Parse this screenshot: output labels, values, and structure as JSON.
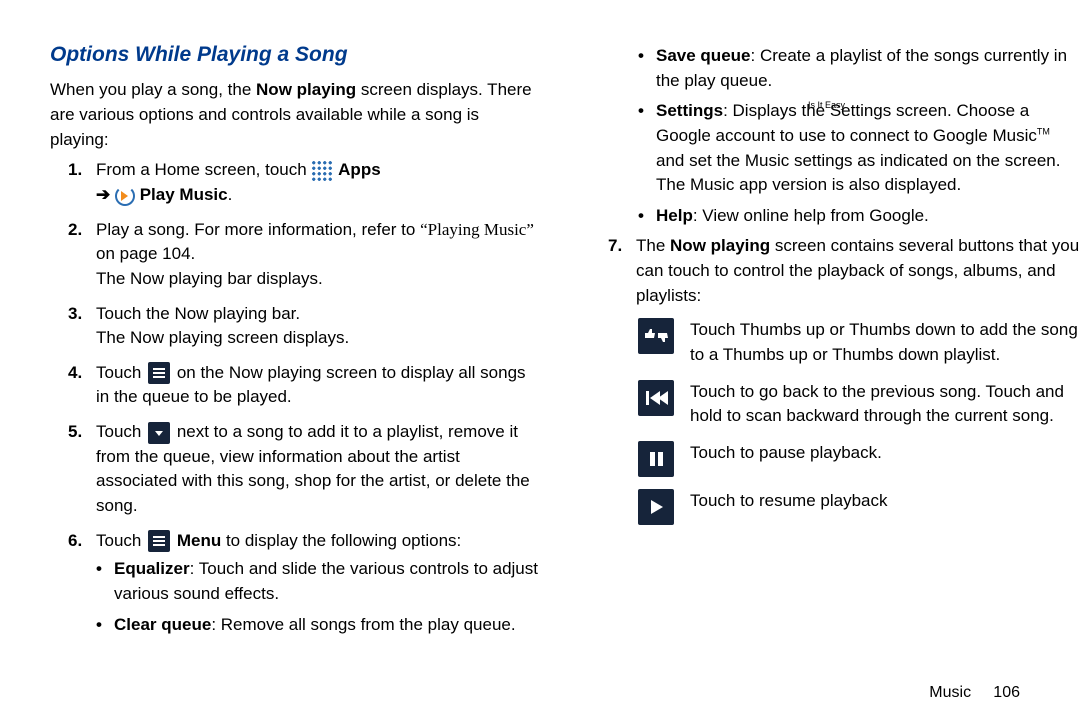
{
  "heading": "Options While Playing a Song",
  "intro": {
    "t1": "When you play a song, the ",
    "b1": "Now playing",
    "t2": " screen displays. There are various options and controls available while a song is playing:"
  },
  "step1": {
    "num": "1.",
    "t1": "From a Home screen, touch ",
    "apps": "Apps",
    "play": "Play Music",
    "dot": "."
  },
  "step2": {
    "num": "2.",
    "t1": "Play a song. For more information, refer to ",
    "ref": "“Playing Music”",
    "t2": " on page 104.",
    "t3": "The Now playing bar displays."
  },
  "step3": {
    "num": "3.",
    "t1": "Touch the Now playing bar.",
    "t2": "The Now playing screen displays."
  },
  "step4": {
    "num": "4.",
    "t1": "Touch ",
    "t2": " on the Now playing screen to display all songs in the queue to be played."
  },
  "step5": {
    "num": "5.",
    "t1": "Touch ",
    "t2": " next to a song to add it to a playlist, remove it from the queue, view information about the artist associated with this song, shop for the artist, or delete the song."
  },
  "step6": {
    "num": "6.",
    "t1": "Touch ",
    "menu": "Menu",
    "t2": " to display the following options:"
  },
  "opt_eq": {
    "label": "Equalizer",
    "text": ": Touch and slide the various controls to adjust various sound effects."
  },
  "opt_clear": {
    "label": "Clear queue",
    "text": ":  Remove all songs from the play queue."
  },
  "opt_save": {
    "label": "Save queue",
    "text": ": Create a playlist of the songs currently in the play queue."
  },
  "opt_settings": {
    "label": "Settings",
    "t1": ": Displays the Settings screen. Choose a Google account to use to connect to Google Music",
    "tm": "TM",
    "overlap": "Is It Easy",
    "t2": " and set the Music settings as indicated on the screen. The Music app version is also displayed."
  },
  "opt_help": {
    "label": "Help",
    "text": ": View online help from Google."
  },
  "step7": {
    "num": "7.",
    "t1": "The ",
    "b1": "Now playing",
    "t2": " screen contains several buttons that you can touch to control the playback of songs, albums, and playlists:"
  },
  "btns": {
    "thumbs": "Touch Thumbs up or Thumbs down to add the song to a Thumbs up or Thumbs down playlist.",
    "prev": "Touch to go back to the previous song. Touch and hold to scan backward through the current song.",
    "pause": "Touch to pause playback.",
    "play": "Touch to resume playback"
  },
  "footer": {
    "section": "Music",
    "page": "106"
  }
}
